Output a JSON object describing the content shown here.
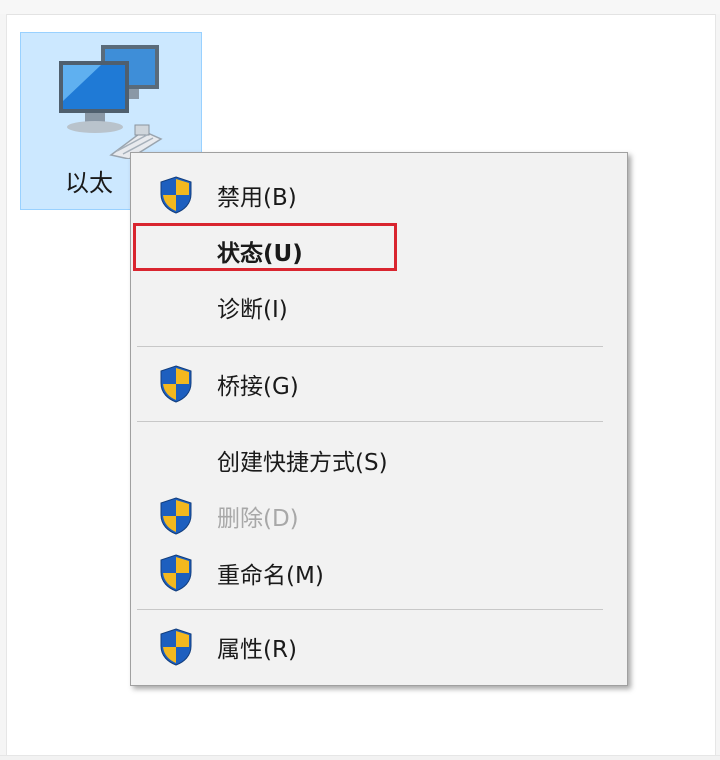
{
  "desktop": {
    "network_item_label": "以太",
    "icon": "network-computer-icon"
  },
  "context_menu": {
    "items": [
      {
        "label": "禁用(B)",
        "icon": "uac-shield-icon"
      },
      {
        "label": "状态(U)",
        "bold": true,
        "highlighted": true
      },
      {
        "label": "诊断(I)"
      },
      {
        "label": "桥接(G)",
        "icon": "uac-shield-icon"
      },
      {
        "label": "创建快捷方式(S)"
      },
      {
        "label": "删除(D)",
        "icon": "uac-shield-icon",
        "disabled": true
      },
      {
        "label": "重命名(M)",
        "icon": "uac-shield-icon"
      },
      {
        "label": "属性(R)",
        "icon": "uac-shield-icon"
      }
    ],
    "highlight_color": "#d9252f",
    "selection_color": "#cce8ff"
  }
}
